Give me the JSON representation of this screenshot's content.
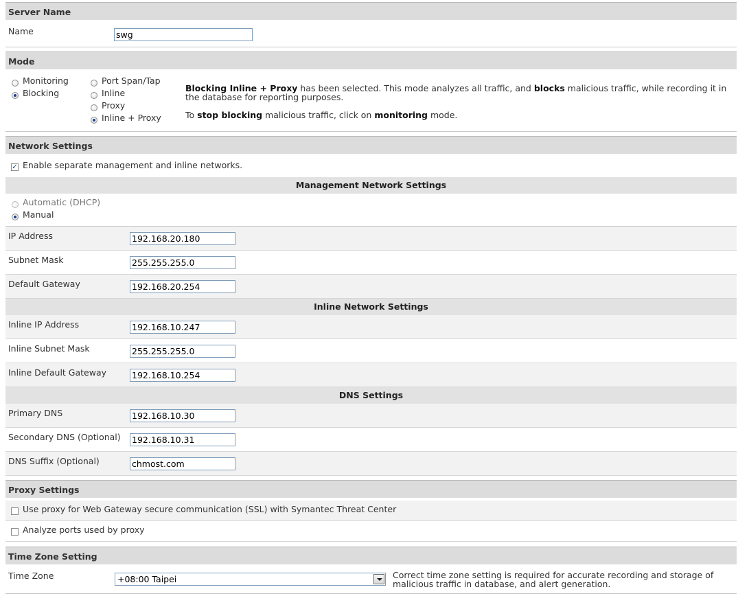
{
  "server_name": {
    "header": "Server Name",
    "name_label": "Name",
    "name_value": "swg"
  },
  "mode": {
    "header": "Mode",
    "primary_options": [
      {
        "label": "Monitoring",
        "selected": false
      },
      {
        "label": "Blocking",
        "selected": true
      }
    ],
    "secondary_options": [
      {
        "label": "Port Span/Tap",
        "selected": false
      },
      {
        "label": "Inline",
        "selected": false
      },
      {
        "label": "Proxy",
        "selected": false
      },
      {
        "label": "Inline + Proxy",
        "selected": true
      }
    ],
    "desc1_bold_mode": "Blocking Inline + Proxy",
    "desc1_text_a": " has been selected. This mode analyzes all traffic, and ",
    "desc1_bold_blocks": "blocks",
    "desc1_text_b": " malicious traffic, while recording it in the database for reporting purposes.",
    "desc2_text_a": "To ",
    "desc2_bold_stop": "stop blocking",
    "desc2_text_b": " malicious traffic, click on ",
    "desc2_bold_monitoring": "monitoring",
    "desc2_text_c": " mode."
  },
  "network": {
    "header": "Network Settings",
    "enable_separate_label": "Enable separate management and inline networks.",
    "enable_separate_checked": true,
    "management": {
      "header": "Management Network Settings",
      "dhcp_label": "Automatic (DHCP)",
      "manual_label": "Manual",
      "manual_selected": true,
      "ip_label": "IP Address",
      "ip_value": "192.168.20.180",
      "subnet_label": "Subnet Mask",
      "subnet_value": "255.255.255.0",
      "gateway_label": "Default Gateway",
      "gateway_value": "192.168.20.254"
    },
    "inline": {
      "header": "Inline Network Settings",
      "ip_label": "Inline IP Address",
      "ip_value": "192.168.10.247",
      "subnet_label": "Inline Subnet Mask",
      "subnet_value": "255.255.255.0",
      "gateway_label": "Inline Default Gateway",
      "gateway_value": "192.168.10.254"
    },
    "dns": {
      "header": "DNS Settings",
      "primary_label": "Primary DNS",
      "primary_value": "192.168.10.30",
      "secondary_label": "Secondary DNS (Optional)",
      "secondary_value": "192.168.10.31",
      "suffix_label": "DNS Suffix (Optional)",
      "suffix_value": "chmost.com"
    }
  },
  "proxy": {
    "header": "Proxy Settings",
    "ssl_label": "Use proxy for Web Gateway secure communication (SSL) with Symantec Threat Center",
    "ssl_checked": false,
    "ports_label": "Analyze ports used by proxy",
    "ports_checked": false
  },
  "timezone": {
    "header": "Time Zone Setting",
    "label": "Time Zone",
    "value": "+08:00 Taipei",
    "note": "Correct time zone setting is required for accurate recording and storage of malicious traffic in database, and alert generation."
  },
  "colors": {
    "section_header_bg": "#dcdcdc",
    "radio_dot": "#1b3f8b",
    "input_border": "#7f9db9"
  }
}
